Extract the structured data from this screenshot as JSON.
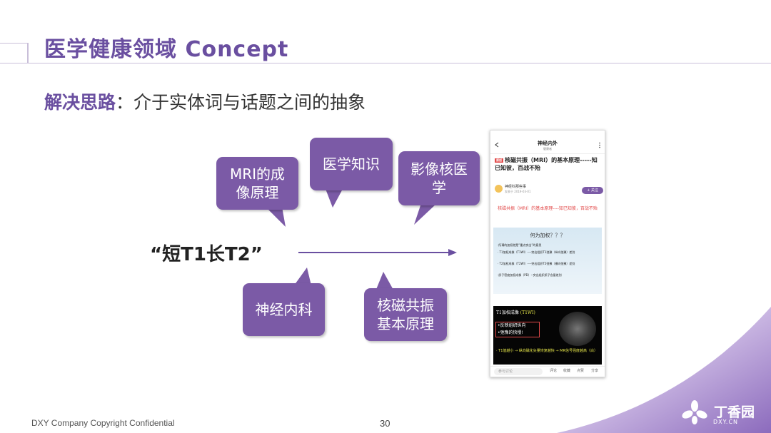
{
  "slide": {
    "title": "医学健康领域 Concept",
    "subtitle_highlight": "解决思路",
    "subtitle_rest": "：介于实体词与话题之间的抽象",
    "query": "“短T1长T2”",
    "footer": "DXY Company Copyright Confidential",
    "page_number": "30",
    "logo_text": "丁香园",
    "logo_sub": "DXY.CN"
  },
  "bubbles": {
    "mri": [
      "MRI的成",
      "像原理"
    ],
    "medical": [
      "医学知识"
    ],
    "imaging": [
      "影像核医",
      "学"
    ],
    "neuro": [
      "神经内科"
    ],
    "nmr": [
      "核磁共振",
      "基本原理"
    ]
  },
  "colors": {
    "accent": "#7b5aa6",
    "title": "#6a4fa0",
    "red": "#e24a4a"
  },
  "phone": {
    "nav_title": "神经内外",
    "nav_sub": "健康者",
    "article_tag": "原创",
    "article_title": "核磁共振（MRI）的基本原理-----知已知彼，百战不殆",
    "author": "神经科那些事",
    "author_sub": "发表于 2019-03-01",
    "follow_label": "+ 关注",
    "red_text": "核磁共振（MRI）的基本原理----知已知彼，百战不殆",
    "slide_heading": "何为加权？？？",
    "slide_lines": [
      "·所谓的加权就是“重点突出”的意思",
      "· T1加权成像（T1WI）----突出组织T1弛豫（纵向弛豫）差别",
      "· T2加权成像（T2WI）----突出组织T2弛豫（横向弛豫）差别",
      "·质子密度加权成像（PD）--突出组织质子含量差别"
    ],
    "mri_heading": "T1加权成像",
    "mri_heading_tag": "(T1WI)",
    "mri_box_lines": [
      "•反映组织纵向",
      "•弛豫的快慢!"
    ],
    "mri_footer": "· T1值越小 → 纵向磁化矢量恢复越快 → MR信号强度越高（白）",
    "comment_placeholder": "参与讨论",
    "bottom_icons": [
      "评论",
      "收藏",
      "点赞",
      "分享"
    ]
  }
}
